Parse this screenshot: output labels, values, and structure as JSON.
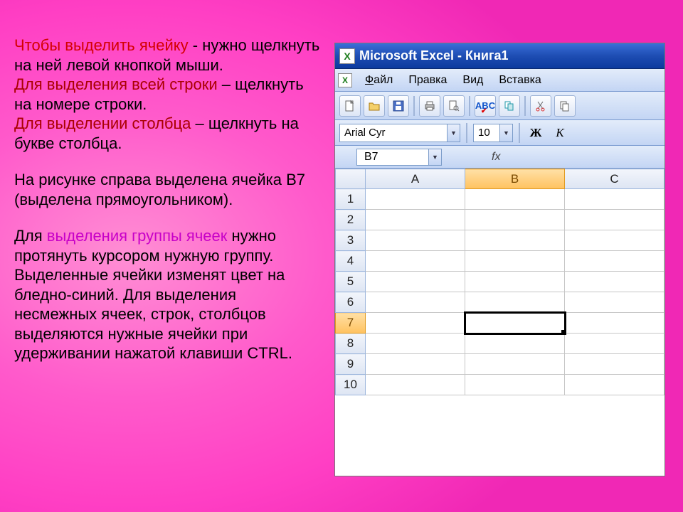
{
  "instructions": {
    "p1": {
      "span1": "Чтобы выделить ячейку",
      "span2": "  -  нужно щелкнуть на ней левой кнопкой мыши.",
      "span3": "Для выделения всей строки",
      "span4": " – щелкнуть на номере строки.",
      "span5": "Для выделении столбца",
      "span6": " – щелкнуть на букве столбца."
    },
    "p2": "На рисунке справа выделена ячейка В7 (выделена прямоугольником).",
    "p3": {
      "span1": "Для ",
      "span2": "выделения группы ячеек",
      "span3": " нужно протянуть курсором нужную группу. Выделенные ячейки изменят цвет на бледно-синий. Для выделения несмежных ячеек, строк, столбцов выделяются нужные ячейки при удерживании нажатой клавиши CTRL."
    }
  },
  "excel": {
    "title": "Microsoft Excel - Книга1",
    "menu": {
      "file": "Файл",
      "edit": "Правка",
      "view": "Вид",
      "insert": "Вставка"
    },
    "format": {
      "font": "Arial Cyr",
      "size": "10",
      "bold": "Ж",
      "italic": "К"
    },
    "formula": {
      "namebox": "B7",
      "fx": "fx"
    },
    "columns": [
      "A",
      "B",
      "C"
    ],
    "rows": [
      "1",
      "2",
      "3",
      "4",
      "5",
      "6",
      "7",
      "8",
      "9",
      "10"
    ],
    "selected": {
      "col": "B",
      "row": "7"
    }
  }
}
